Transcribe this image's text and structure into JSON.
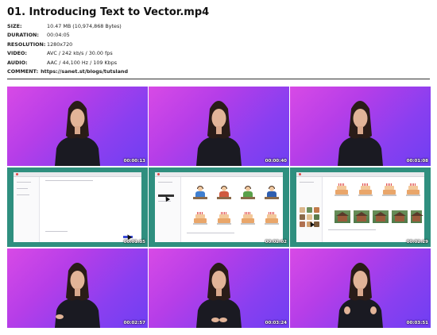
{
  "title": "01. Introducing Text to Vector.mp4",
  "meta": [
    {
      "key": "SIZE:",
      "value": "10.47 MB (10,974,868 Bytes)"
    },
    {
      "key": "DURATION:",
      "value": "00:04:05"
    },
    {
      "key": "RESOLUTION:",
      "value": "1280x720"
    },
    {
      "key": "VIDEO:",
      "value": "AVC / 242 kb/s / 30.00 fps"
    },
    {
      "key": "AUDIO:",
      "value": "AAC / 44,100 Hz / 109 Kbps"
    }
  ],
  "comment": {
    "key": "COMMENT:",
    "value": "https://sanet.st/blogs/tutsland"
  },
  "colors": {
    "speaker_bg_start": "#d84ae6",
    "speaker_bg_end": "#6f3ff2",
    "screen_bg": "#2f8f7f"
  },
  "thumbnails": [
    {
      "kind": "speaker",
      "timestamp": "00:00:13"
    },
    {
      "kind": "speaker",
      "timestamp": "00:00:40"
    },
    {
      "kind": "speaker",
      "timestamp": "00:01:08"
    },
    {
      "kind": "screen",
      "timestamp": "00:01:35"
    },
    {
      "kind": "screen",
      "timestamp": "00:02:02"
    },
    {
      "kind": "screen",
      "timestamp": "00:02:29"
    },
    {
      "kind": "speaker",
      "timestamp": "00:02:57"
    },
    {
      "kind": "speaker",
      "timestamp": "00:03:24"
    },
    {
      "kind": "speaker",
      "timestamp": "00:03:51"
    }
  ]
}
